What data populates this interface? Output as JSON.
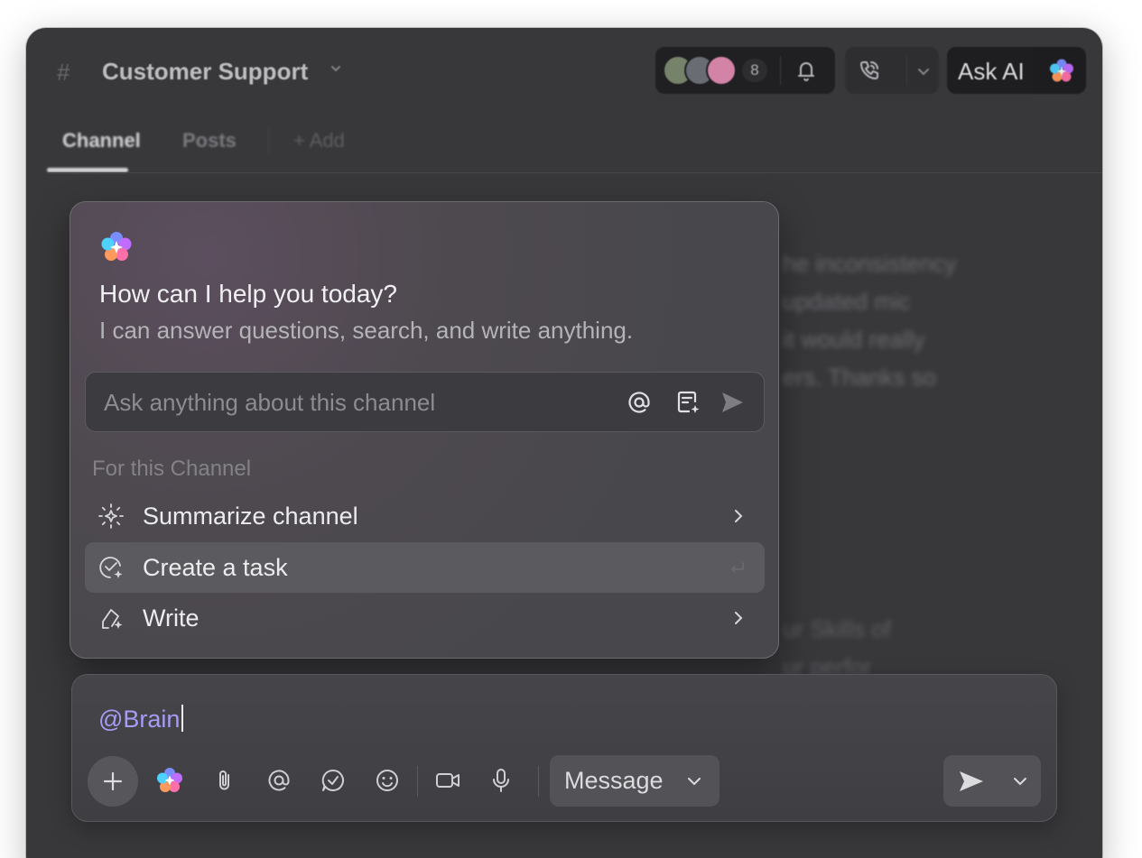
{
  "channel": {
    "hash_symbol": "#",
    "title": "Customer Support",
    "member_count": "8"
  },
  "header": {
    "ask_ai_label": "Ask AI"
  },
  "tabs": [
    {
      "label": "Channel"
    },
    {
      "label": "Posts"
    },
    {
      "label": "+ Add"
    }
  ],
  "background_messages": {
    "lines_top": [
      "he inconsistency",
      "updated mic",
      "it would really",
      "ers. Thanks so"
    ],
    "lines_bottom": [
      "ur Skills of",
      "ur perfor"
    ]
  },
  "ai_popup": {
    "title": "How can I help you today?",
    "subtitle": "I can answer questions, search, and write anything.",
    "input_placeholder": "Ask anything about this channel",
    "section_label": "For this Channel",
    "items": [
      {
        "label": "Summarize channel",
        "icon": "sparkle-burst-icon",
        "trailing": "chevron-right-icon"
      },
      {
        "label": "Create a task",
        "icon": "task-check-icon",
        "trailing": "enter-icon",
        "active": true
      },
      {
        "label": "Write",
        "icon": "pen-icon",
        "trailing": "chevron-right-icon"
      }
    ]
  },
  "composer": {
    "text": "@Brain",
    "message_type": "Message"
  },
  "colors": {
    "accent_mention": "#a69cf4",
    "window_bg": "#38383b",
    "popup_active_row": "#5b5b5f"
  }
}
